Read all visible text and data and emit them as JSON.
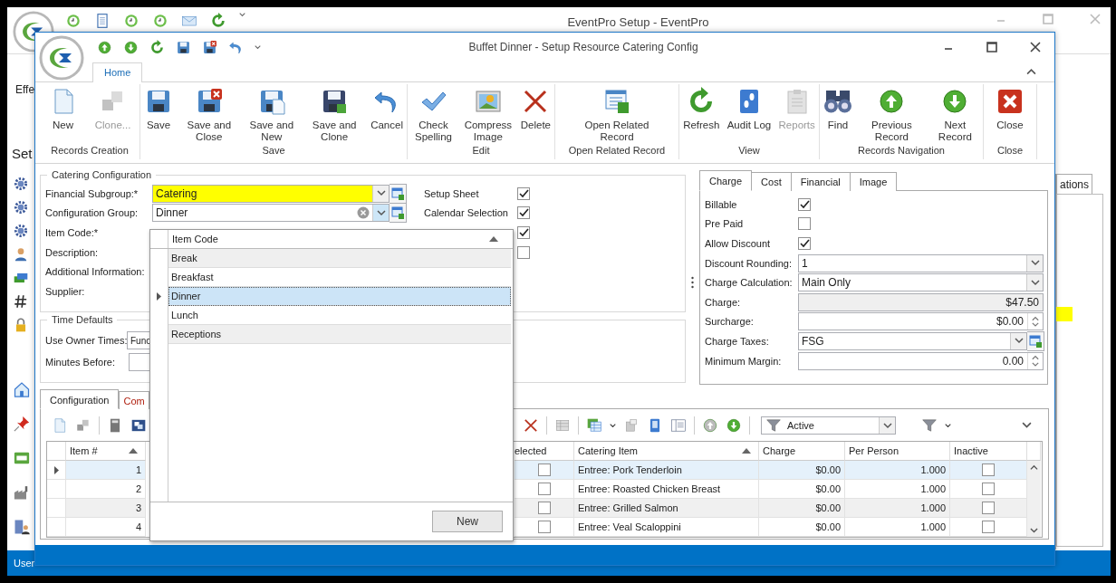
{
  "background_window": {
    "title": "EventPro Setup - EventPro",
    "ribbon_fragment": "Effe",
    "pane_fragment": "Set",
    "tab_fragment": "ations",
    "status_fragment": "User"
  },
  "window": {
    "title": "Buffet Dinner - Setup Resource Catering Config"
  },
  "ribbon": {
    "tabs": [
      {
        "label": "Home",
        "selected": true
      }
    ],
    "groups": [
      {
        "label": "Records Creation",
        "buttons": [
          {
            "label": "New",
            "disabled": false
          },
          {
            "label": "Clone...",
            "disabled": true
          }
        ]
      },
      {
        "label": "Save",
        "buttons": [
          {
            "label": "Save",
            "disabled": false
          },
          {
            "label": "Save and Close",
            "disabled": false
          },
          {
            "label": "Save and New",
            "disabled": false
          },
          {
            "label": "Save and Clone",
            "disabled": false
          },
          {
            "label": "Cancel",
            "disabled": false
          }
        ]
      },
      {
        "label": "Edit",
        "buttons": [
          {
            "label": "Check Spelling",
            "disabled": false
          },
          {
            "label": "Compress Image",
            "disabled": false
          },
          {
            "label": "Delete",
            "disabled": false
          }
        ]
      },
      {
        "label": "Open Related Record",
        "buttons": [
          {
            "label": "Open Related Record",
            "disabled": false
          }
        ]
      },
      {
        "label": "View",
        "buttons": [
          {
            "label": "Refresh",
            "disabled": false
          },
          {
            "label": "Audit Log",
            "disabled": false
          },
          {
            "label": "Reports",
            "disabled": true
          }
        ]
      },
      {
        "label": "Records Navigation",
        "buttons": [
          {
            "label": "Find",
            "disabled": false
          },
          {
            "label": "Previous Record",
            "disabled": false
          },
          {
            "label": "Next Record",
            "disabled": false
          }
        ]
      },
      {
        "label": "Close",
        "buttons": [
          {
            "label": "Close",
            "disabled": false
          }
        ]
      }
    ]
  },
  "catering_configuration": {
    "title": "Catering Configuration",
    "fields": [
      {
        "label": "Financial Subgroup:*",
        "value": "Catering",
        "highlighted": true
      },
      {
        "label": "Configuration Group:",
        "value": "Dinner",
        "highlighted": false,
        "open": true
      },
      {
        "label": "Item Code:*"
      },
      {
        "label": "Description:"
      },
      {
        "label": "Additional Information:"
      },
      {
        "label": "Supplier:"
      }
    ],
    "checks": [
      {
        "label": "Setup Sheet",
        "checked": true
      },
      {
        "label": "Calendar Selection",
        "checked": true
      },
      {
        "checked": true
      },
      {
        "checked": false
      }
    ]
  },
  "time_defaults": {
    "title": "Time Defaults",
    "fields": [
      {
        "label": "Use Owner Times:",
        "value": "Func"
      },
      {
        "label": "Minutes Before:"
      }
    ]
  },
  "charge_panel": {
    "tabs": [
      {
        "label": "Charge",
        "selected": true
      },
      {
        "label": "Cost",
        "selected": false
      },
      {
        "label": "Financial",
        "selected": false
      },
      {
        "label": "Image",
        "selected": false
      }
    ],
    "rows": [
      {
        "kind": "check",
        "label": "Billable",
        "checked": true
      },
      {
        "kind": "check",
        "label": "Pre Paid",
        "checked": false
      },
      {
        "kind": "check",
        "label": "Allow Discount",
        "checked": true
      },
      {
        "kind": "combo",
        "label": "Discount Rounding:",
        "value": "1"
      },
      {
        "kind": "combo",
        "label": "Charge Calculation:",
        "value": "Main Only"
      },
      {
        "kind": "readonly",
        "label": "Charge:",
        "value": "$47.50"
      },
      {
        "kind": "spin",
        "label": "Surcharge:",
        "value": "$0.00"
      },
      {
        "kind": "lookup",
        "label": "Charge Taxes:",
        "value": "FSG"
      },
      {
        "kind": "spin",
        "label": "Minimum Margin:",
        "value": "0.00"
      }
    ]
  },
  "bottom": {
    "tabs": [
      {
        "label": "Configuration",
        "selected": true
      },
      {
        "label": "Com",
        "selected": false
      }
    ],
    "filter": "Active",
    "columns": [
      {
        "label": "Item #",
        "sorted": true
      },
      {
        "label": "elected",
        "sorted": false
      },
      {
        "label": "Catering Item",
        "sorted": true
      },
      {
        "label": "Charge",
        "sorted": false
      },
      {
        "label": "Per Person",
        "sorted": false
      },
      {
        "label": "Inactive",
        "sorted": false
      }
    ],
    "rows": [
      {
        "item": "1",
        "selected_box": false,
        "catering_item": "Entree: Pork Tenderloin",
        "charge": "$0.00",
        "per_person": "1.000",
        "inactive": false,
        "selected": true
      },
      {
        "item": "2",
        "selected_box": false,
        "catering_item": "Entree: Roasted Chicken Breast",
        "charge": "$0.00",
        "per_person": "1.000",
        "inactive": false,
        "selected": false
      },
      {
        "item": "3",
        "selected_box": false,
        "catering_item": "Entree: Grilled Salmon",
        "charge": "$0.00",
        "per_person": "1.000",
        "inactive": false,
        "selected": false
      },
      {
        "item": "4",
        "selected_box": false,
        "catering_item": "Entree: Veal Scaloppini",
        "charge": "$0.00",
        "per_person": "1.000",
        "inactive": false,
        "selected": false
      }
    ]
  },
  "dropdown": {
    "header": "Item Code",
    "items": [
      {
        "label": "Break",
        "selected": false
      },
      {
        "label": "Breakfast",
        "selected": false
      },
      {
        "label": "Dinner",
        "selected": true
      },
      {
        "label": "Lunch",
        "selected": false
      },
      {
        "label": "Receptions",
        "selected": false
      }
    ],
    "button": "New"
  }
}
